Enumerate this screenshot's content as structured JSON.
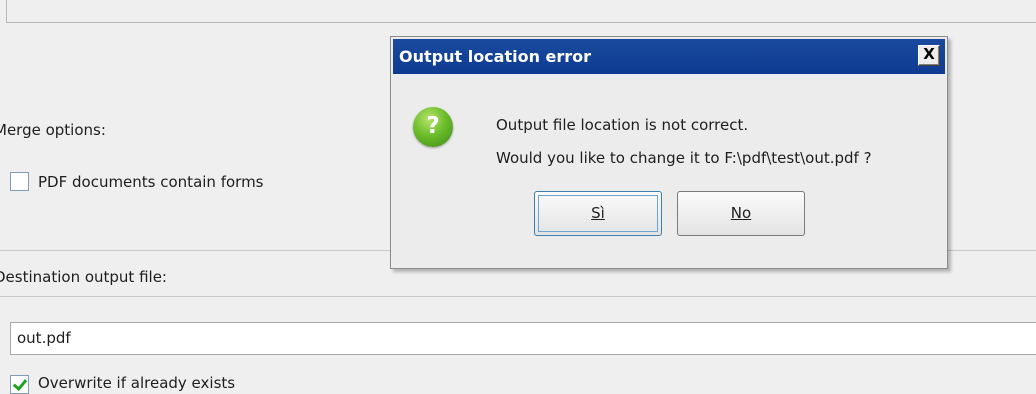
{
  "background": {
    "merge_options_label": "Merge options:",
    "forms_checkbox_label": "PDF documents contain forms",
    "forms_checkbox_checked": false,
    "destination_label": "Destination output file:",
    "output_file_value": "out.pdf",
    "overwrite_label": "Overwrite if already exists",
    "overwrite_checked": true
  },
  "dialog": {
    "title": "Output location error",
    "close_label": "X",
    "icon": "question-icon",
    "icon_glyph": "?",
    "message_line1": "Output file location is not correct.",
    "message_line2": "Would you like to change it to F:\\pdf\\test\\out.pdf ?",
    "yes_label": "Sì",
    "no_label": "No",
    "focused_button": "yes",
    "colors": {
      "titlebar": "#0e3b91",
      "title_text": "#ffffff",
      "icon": "#6cbd2c",
      "checkmark": "#21a121"
    }
  }
}
